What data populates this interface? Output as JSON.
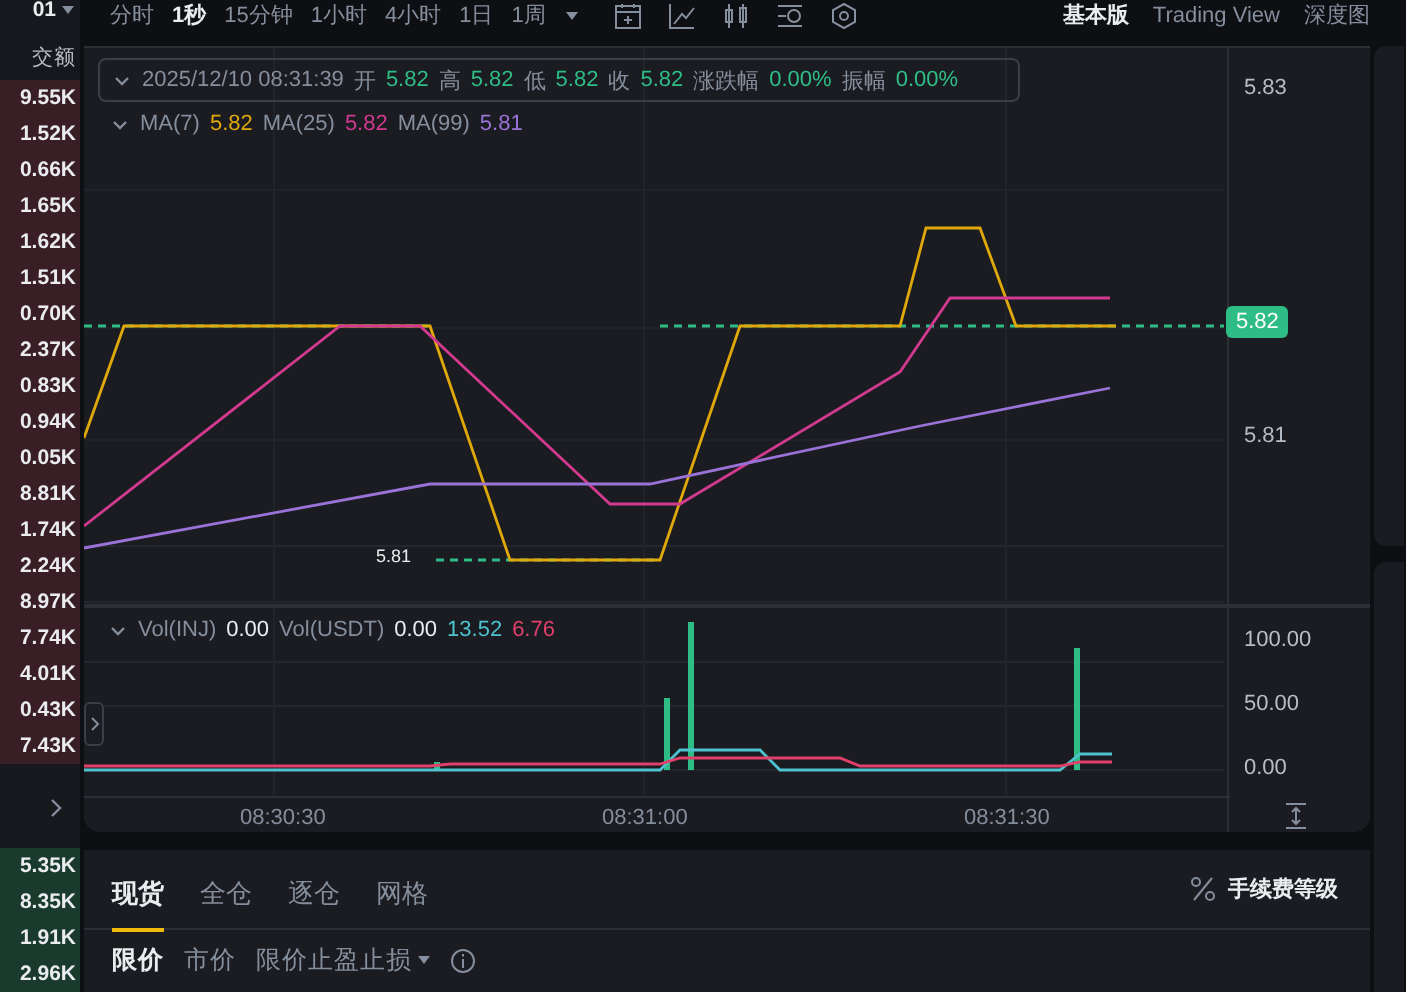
{
  "order_book": {
    "pair_suffix": "01",
    "header": "交额",
    "sell_rows": [
      "9.55K",
      "1.52K",
      "0.66K",
      "1.65K",
      "1.62K",
      "1.51K",
      "0.70K",
      "2.37K",
      "0.83K",
      "0.94K",
      "0.05K",
      "8.81K",
      "1.74K",
      "2.24K",
      "8.97K",
      "7.74K",
      "4.01K",
      "0.43K",
      "7.43K"
    ],
    "buy_rows": [
      "5.35K",
      "8.35K",
      "1.91K",
      "2.96K"
    ]
  },
  "toolbar": {
    "intervals": [
      {
        "label": "分时",
        "selected": false
      },
      {
        "label": "1秒",
        "selected": true
      },
      {
        "label": "15分钟",
        "selected": false
      },
      {
        "label": "1小时",
        "selected": false
      },
      {
        "label": "4小时",
        "selected": false
      },
      {
        "label": "1日",
        "selected": false
      },
      {
        "label": "1周",
        "selected": false
      }
    ],
    "views": [
      {
        "label": "基本版",
        "selected": true
      },
      {
        "label": "Trading View",
        "selected": false
      },
      {
        "label": "深度图",
        "selected": false
      }
    ]
  },
  "chart": {
    "legend": {
      "datetime": "2025/12/10 08:31:39",
      "fields": [
        {
          "label": "开",
          "value": "5.82"
        },
        {
          "label": "高",
          "value": "5.82"
        },
        {
          "label": "低",
          "value": "5.82"
        },
        {
          "label": "收",
          "value": "5.82"
        },
        {
          "label": "涨跌幅",
          "value": "0.00%"
        },
        {
          "label": "振幅",
          "value": "0.00%"
        }
      ]
    },
    "moving_averages": [
      {
        "label": "MA(7)",
        "value": "5.82",
        "color": "#e0a80b"
      },
      {
        "label": "MA(25)",
        "value": "5.82",
        "color": "#d13a8f"
      },
      {
        "label": "MA(99)",
        "value": "5.81",
        "color": "#9a72d8"
      }
    ],
    "low_marker": "5.81",
    "price_ticks": [
      "5.83",
      "5.81"
    ],
    "current_price": "5.82",
    "volume_legend": [
      {
        "label": "Vol(INJ)",
        "value": "0.00"
      },
      {
        "label": "Vol(USDT)",
        "value": "0.00"
      }
    ],
    "volume_ma": [
      {
        "value": "13.52",
        "color": "#4cc3cf"
      },
      {
        "value": "6.76",
        "color": "#e0406a"
      }
    ],
    "volume_ticks": [
      "100.00",
      "50.00",
      "0.00"
    ],
    "time_ticks": [
      "08:30:30",
      "08:31:00",
      "08:31:30"
    ]
  },
  "order_panel": {
    "tabs": [
      {
        "label": "现货",
        "selected": true
      },
      {
        "label": "全仓",
        "selected": false
      },
      {
        "label": "逐仓",
        "selected": false
      },
      {
        "label": "网格",
        "selected": false
      }
    ],
    "fee_label": "手续费等级",
    "order_types": [
      {
        "label": "限价",
        "selected": true,
        "kind": "plain"
      },
      {
        "label": "市价",
        "selected": false,
        "kind": "plain"
      },
      {
        "label": "限价止盈止损",
        "selected": false,
        "kind": "dropdown"
      }
    ]
  }
}
